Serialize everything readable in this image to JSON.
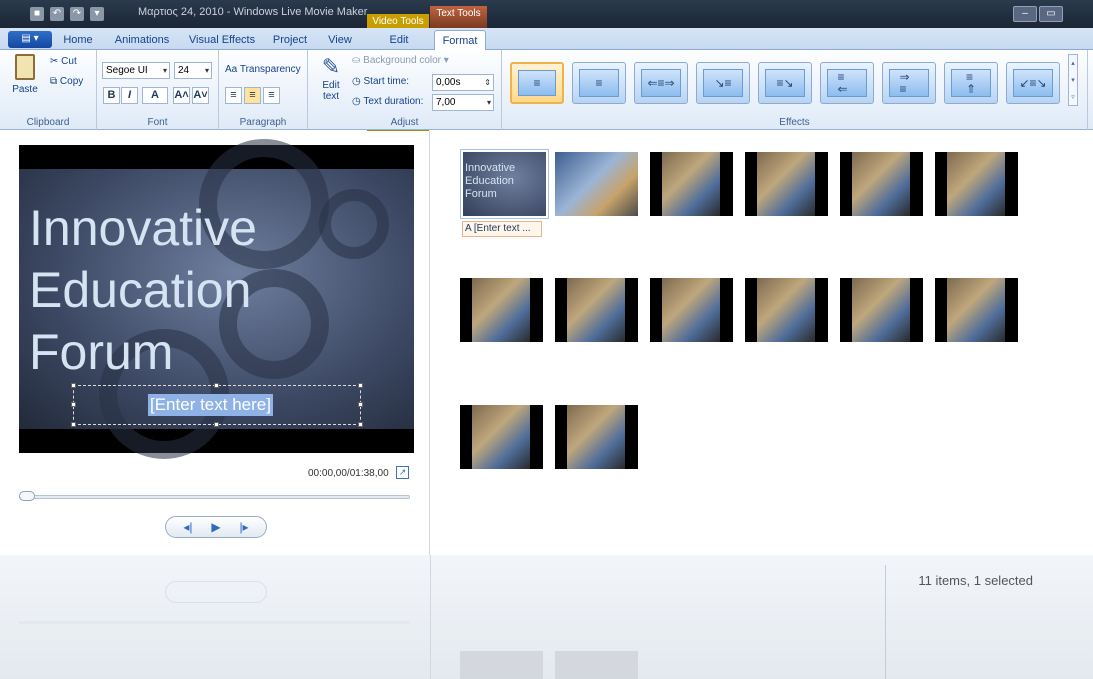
{
  "window": {
    "title": "Μαρτιος 24, 2010 - Windows Live Movie Maker",
    "context_tabs": {
      "video_tools": "Video Tools",
      "text_tools": "Text Tools"
    }
  },
  "tabs": {
    "app_menu": "▤ ▾",
    "items": [
      {
        "label": "Home"
      },
      {
        "label": "Animations"
      },
      {
        "label": "Visual Effects"
      },
      {
        "label": "Project"
      },
      {
        "label": "View"
      },
      {
        "label": "Edit"
      },
      {
        "label": "Format"
      }
    ],
    "active": "Format"
  },
  "ribbon": {
    "clipboard": {
      "label": "Clipboard",
      "paste": "Paste",
      "cut": "Cut",
      "copy": "Copy"
    },
    "font": {
      "label": "Font",
      "family": "Segoe UI",
      "size": "24",
      "bold": "B",
      "italic": "I",
      "color": "A",
      "grow": "A˄",
      "shrink": "A˅"
    },
    "paragraph": {
      "label": "Paragraph",
      "transparency": "Transparency"
    },
    "adjust": {
      "label": "Adjust",
      "edit_text": "Edit text",
      "background_color": "Background color",
      "start_time_label": "Start time:",
      "start_time_value": "0,00s",
      "text_duration_label": "Text duration:",
      "text_duration_value": "7,00"
    },
    "effects": {
      "label": "Effects"
    }
  },
  "preview": {
    "title_text": "Innovative\nEducation\nForum",
    "placeholder": "[Enter text here]",
    "time": "00:00,00/01:38,00"
  },
  "storyboard": {
    "first_caption": "A [Enter text ...",
    "first_thumb_text": "Innovative\nEducation\nForum"
  },
  "status": {
    "selection": "11 items, 1 selected"
  }
}
